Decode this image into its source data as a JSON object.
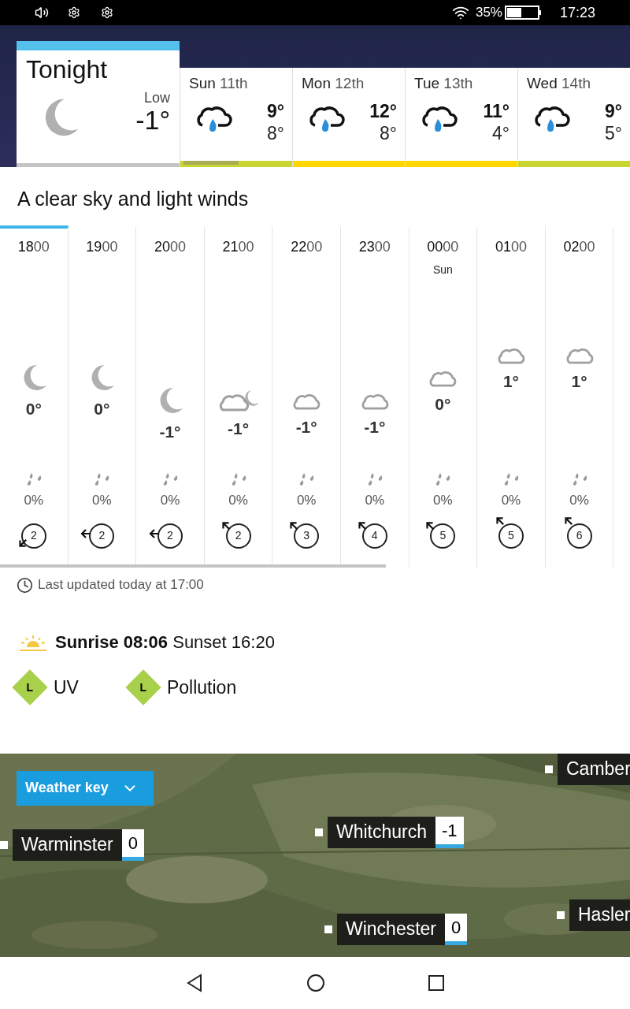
{
  "status_bar": {
    "battery": "35%",
    "time": "17:23"
  },
  "tonight": {
    "title": "Tonight",
    "low_label": "Low",
    "low": "-1°",
    "selected": true
  },
  "days": [
    {
      "day": "Sun",
      "date": "11th",
      "high": "9°",
      "low": "8°",
      "color": "#c8d62f",
      "selected": false
    },
    {
      "day": "Mon",
      "date": "12th",
      "high": "12°",
      "low": "8°",
      "color": "#ffd700",
      "selected": false
    },
    {
      "day": "Tue",
      "date": "13th",
      "high": "11°",
      "low": "4°",
      "color": "#ffd700",
      "selected": false
    },
    {
      "day": "Wed",
      "date": "14th",
      "high": "9°",
      "low": "5°",
      "color": "#c8d62f",
      "selected": false
    }
  ],
  "summary": "A clear sky and light winds",
  "hours": [
    {
      "hour": "18",
      "minutes": "00",
      "kind": "moon",
      "temp": "0°",
      "rain": "0%",
      "wind": {
        "speed": "2",
        "kind": "down-left"
      },
      "selected": true
    },
    {
      "hour": "19",
      "minutes": "00",
      "kind": "moon",
      "temp": "0°",
      "rain": "0%",
      "wind": {
        "speed": "2",
        "kind": "left"
      },
      "selected": false
    },
    {
      "hour": "20",
      "minutes": "00",
      "kind": "moon",
      "temp": "-1°",
      "rain": "0%",
      "wind": {
        "speed": "2",
        "kind": "left"
      },
      "selected": false
    },
    {
      "hour": "21",
      "minutes": "00",
      "kind": "cloud_moon",
      "temp": "-1°",
      "rain": "0%",
      "wind": {
        "speed": "2",
        "kind": "upleft"
      },
      "selected": false
    },
    {
      "hour": "22",
      "minutes": "00",
      "kind": "cloud",
      "temp": "-1°",
      "rain": "0%",
      "wind": {
        "speed": "3",
        "kind": "upleft"
      },
      "selected": false
    },
    {
      "hour": "23",
      "minutes": "00",
      "kind": "cloud",
      "temp": "-1°",
      "rain": "0%",
      "wind": {
        "speed": "4",
        "kind": "upleft"
      },
      "selected": false
    },
    {
      "hour": "00",
      "minutes": "00",
      "day": "Sun",
      "kind": "cloud",
      "temp": "0°",
      "rain": "0%",
      "wind": {
        "speed": "5",
        "kind": "upleft"
      },
      "selected": false
    },
    {
      "hour": "01",
      "minutes": "00",
      "kind": "cloud",
      "temp": "1°",
      "rain": "0%",
      "wind": {
        "speed": "5",
        "kind": "upleft_high"
      },
      "selected": false
    },
    {
      "hour": "02",
      "minutes": "00",
      "kind": "cloud",
      "temp": "1°",
      "rain": "0%",
      "wind": {
        "speed": "6",
        "kind": "upleft_high"
      },
      "selected": false
    }
  ],
  "last_updated": "Last updated today at 17:00",
  "sun": {
    "sunrise": "Sunrise 08:06",
    "sunset": "Sunset 16:20"
  },
  "indices": [
    {
      "badge": "L",
      "label": "UV",
      "color": "#a8d04a"
    },
    {
      "badge": "L",
      "label": "Pollution",
      "color": "#a8d04a"
    }
  ],
  "map": {
    "weather_key": "Weather key",
    "places": [
      {
        "name": "Camber"
      },
      {
        "name": "Warminster",
        "temp": "0"
      },
      {
        "name": "Whitchurch",
        "temp": "-1"
      },
      {
        "name": "Hasler"
      },
      {
        "name": "Winchester",
        "temp": "0"
      }
    ]
  }
}
